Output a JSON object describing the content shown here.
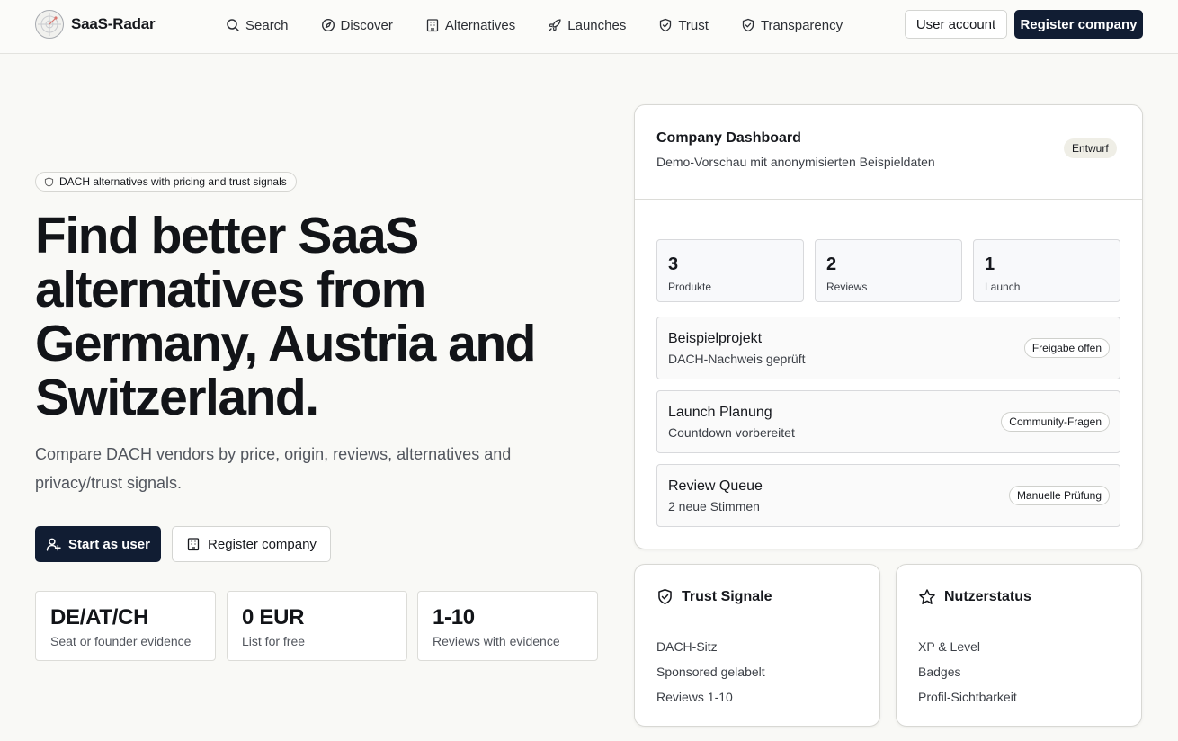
{
  "header": {
    "logo_text": "SaaS-Radar",
    "nav": [
      {
        "label": "Search",
        "icon": "search-icon"
      },
      {
        "label": "Discover",
        "icon": "compass-icon"
      },
      {
        "label": "Alternatives",
        "icon": "building-icon"
      },
      {
        "label": "Launches",
        "icon": "rocket-icon"
      },
      {
        "label": "Trust",
        "icon": "shield-icon"
      },
      {
        "label": "Transparency",
        "icon": "shield-icon"
      }
    ],
    "account_label": "User account",
    "register_label": "Register company"
  },
  "hero": {
    "pill": "DACH alternatives with pricing and trust signals",
    "title": "Find better SaaS alternatives from Germany, Austria and Switzerland.",
    "subtitle": "Compare DACH vendors by price, origin, reviews, alternatives and privacy/trust signals.",
    "start_label": "Start as user",
    "company_label": "Register company",
    "stats": [
      {
        "value": "DE/AT/CH",
        "label": "Seat or founder evidence"
      },
      {
        "value": "0 EUR",
        "label": "List for free"
      },
      {
        "value": "1-10",
        "label": "Reviews with evidence"
      }
    ]
  },
  "dashboard": {
    "title": "Company Dashboard",
    "subtitle": "Demo-Vorschau mit anonymisierten Beispieldaten",
    "badge": "Entwurf",
    "metrics": [
      {
        "value": "3",
        "label": "Produkte"
      },
      {
        "value": "2",
        "label": "Reviews"
      },
      {
        "value": "1",
        "label": "Launch"
      }
    ],
    "rows": [
      {
        "title": "Beispielprojekt",
        "sub": "DACH-Nachweis geprüft",
        "tag": "Freigabe offen"
      },
      {
        "title": "Launch Planung",
        "sub": "Countdown vorbereitet",
        "tag": "Community-Fragen"
      },
      {
        "title": "Review Queue",
        "sub": "2 neue Stimmen",
        "tag": "Manuelle Prüfung"
      }
    ]
  },
  "trust": {
    "title": "Trust Signale",
    "items": [
      "DACH-Sitz",
      "Sponsored gelabelt",
      "Reviews 1-10"
    ]
  },
  "user_status": {
    "title": "Nutzerstatus",
    "items": [
      "XP & Level",
      "Badges",
      "Profil-Sichtbarkeit"
    ]
  },
  "colors": {
    "primary": "#111d33",
    "background": "#f9f9f6",
    "badge_bg": "#efeee6"
  }
}
